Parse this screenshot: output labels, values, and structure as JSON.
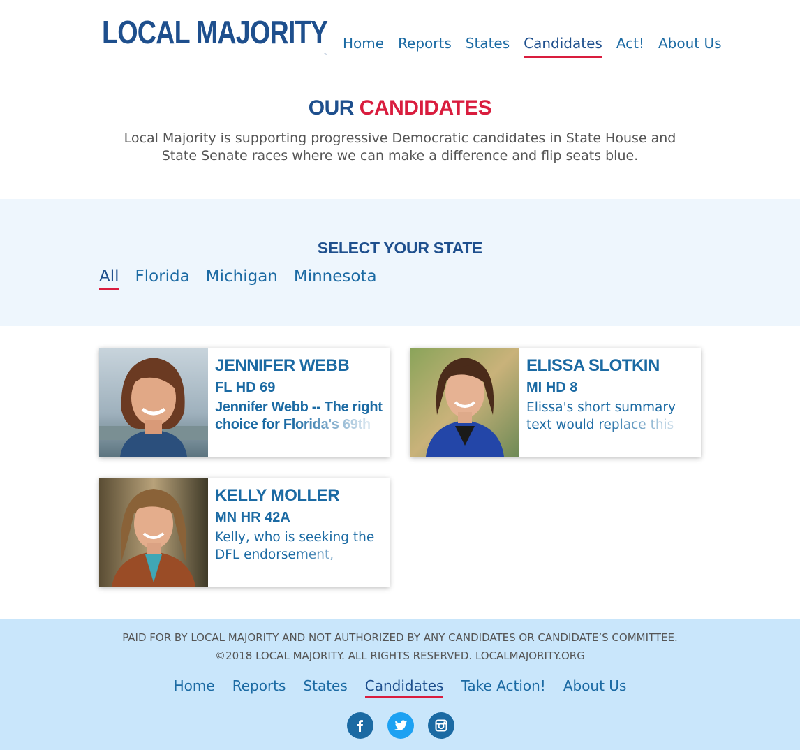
{
  "brand": {
    "name": "LOCAL MAJORITY",
    "tm": "™"
  },
  "nav": {
    "items": [
      {
        "label": "Home",
        "active": false
      },
      {
        "label": "Reports",
        "active": false
      },
      {
        "label": "States",
        "active": false
      },
      {
        "label": "Candidates",
        "active": true
      },
      {
        "label": "Act!",
        "active": false
      },
      {
        "label": "About Us",
        "active": false
      }
    ]
  },
  "intro": {
    "title_part1": "OUR",
    "title_part2": "CANDIDATES",
    "description": "Local Majority is supporting progressive Democratic candidates in State House and State Senate races where we can make a difference and flip seats blue."
  },
  "state_selector": {
    "title": "SELECT YOUR STATE",
    "options": [
      {
        "label": "All",
        "active": true
      },
      {
        "label": "Florida",
        "active": false
      },
      {
        "label": "Michigan",
        "active": false
      },
      {
        "label": "Minnesota",
        "active": false
      }
    ]
  },
  "candidates": [
    {
      "name": "JENNIFER WEBB",
      "district": "FL HD 69",
      "summary": "Jennifer Webb -- The right choice for Florida's 69th"
    },
    {
      "name": "ELISSA SLOTKIN",
      "district": "MI HD 8",
      "summary": "Elissa's short summary text would replace this"
    },
    {
      "name": "KELLY MOLLER",
      "district": "MN HR 42A",
      "summary": "Kelly, who is seeking the DFL endorsement,"
    }
  ],
  "footer": {
    "disclaimer_line1": "PAID FOR BY LOCAL MAJORITY AND NOT AUTHORIZED BY ANY CANDIDATES OR CANDIDATE’S COMMITTEE.",
    "disclaimer_line2": "©2018 LOCAL MAJORITY. ALL RIGHTS RESERVED. LOCALMAJORITY.ORG",
    "nav": [
      {
        "label": "Home",
        "active": false
      },
      {
        "label": "Reports",
        "active": false
      },
      {
        "label": "States",
        "active": false
      },
      {
        "label": "Candidates",
        "active": true
      },
      {
        "label": "Take Action!",
        "active": false
      },
      {
        "label": "About Us",
        "active": false
      }
    ],
    "social": [
      "facebook-icon",
      "twitter-icon",
      "instagram-icon"
    ]
  },
  "colors": {
    "brand_blue": "#1e4f8d",
    "link_blue": "#1b6aa3",
    "accent_red": "#d91d3e",
    "band_bg": "#eef6fd",
    "footer_bg": "#c9e6fb"
  }
}
